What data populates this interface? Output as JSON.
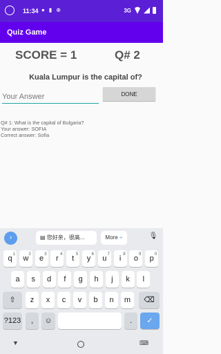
{
  "status": {
    "time": "11:34",
    "network": "3G"
  },
  "app": {
    "title": "Quiz Game"
  },
  "score": {
    "label": "SCORE = 1"
  },
  "question_number": {
    "label": "Q# 2"
  },
  "question": {
    "text": "Kuala Lumpur is the capital of?"
  },
  "answer": {
    "placeholder": "Your Answer",
    "value": ""
  },
  "done_button": {
    "label": "DONE"
  },
  "history": {
    "line1": "Q# 1: What is the capital of Bulgaria?",
    "line2": "Your answer: SOFIA",
    "line3": "Correct answer: Sofia"
  },
  "keyboard": {
    "suggestion": "您好亲，很高...",
    "more": "More",
    "row1": [
      {
        "k": "q",
        "h": "1"
      },
      {
        "k": "w",
        "h": "2"
      },
      {
        "k": "e",
        "h": "3"
      },
      {
        "k": "r",
        "h": "4"
      },
      {
        "k": "t",
        "h": "5"
      },
      {
        "k": "y",
        "h": "6"
      },
      {
        "k": "u",
        "h": "7"
      },
      {
        "k": "i",
        "h": "8"
      },
      {
        "k": "o",
        "h": "9"
      },
      {
        "k": "p",
        "h": "0"
      }
    ],
    "row2": [
      "a",
      "s",
      "d",
      "f",
      "g",
      "h",
      "j",
      "k",
      "l"
    ],
    "row3": [
      "z",
      "x",
      "c",
      "v",
      "b",
      "n",
      "m"
    ],
    "numbers": "?123",
    "comma": ",",
    "period": ".",
    "emoji": "☺"
  }
}
